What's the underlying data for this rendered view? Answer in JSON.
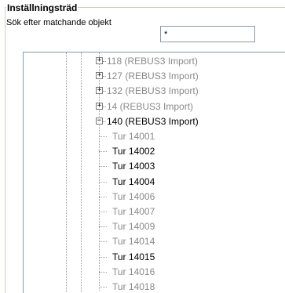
{
  "panel": {
    "title": "Inställningsträd",
    "search_label": "Sök efter matchande objekt",
    "search_value": "*"
  },
  "tree": {
    "parents": [
      {
        "label": "118 (REBUS3 Import)",
        "state": "collapsed",
        "enabled": false
      },
      {
        "label": "127 (REBUS3 Import)",
        "state": "collapsed",
        "enabled": false
      },
      {
        "label": "132 (REBUS3 Import)",
        "state": "collapsed",
        "enabled": false
      },
      {
        "label": "14 (REBUS3 Import)",
        "state": "collapsed",
        "enabled": false
      },
      {
        "label": "140 (REBUS3 Import)",
        "state": "expanded",
        "enabled": true
      }
    ],
    "children": [
      {
        "label": "Tur 14001",
        "enabled": false
      },
      {
        "label": "Tur 14002",
        "enabled": true
      },
      {
        "label": "Tur 14003",
        "enabled": true
      },
      {
        "label": "Tur 14004",
        "enabled": true
      },
      {
        "label": "Tur 14006",
        "enabled": false
      },
      {
        "label": "Tur 14007",
        "enabled": false
      },
      {
        "label": "Tur 14009",
        "enabled": false
      },
      {
        "label": "Tur 14014",
        "enabled": false
      },
      {
        "label": "Tur 14015",
        "enabled": true
      },
      {
        "label": "Tur 14016",
        "enabled": false
      },
      {
        "label": "Tur 14018",
        "enabled": false
      }
    ]
  }
}
